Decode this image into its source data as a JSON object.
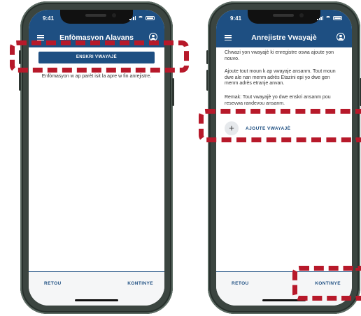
{
  "status_time": "9:41",
  "left_screen": {
    "title": "Enfòmasyon Alavans",
    "primary_button": "ENSKRI VWAYAJÈ",
    "info_text": "Enfòmasyon w ap parèt isit la apre w fin anrejistre.",
    "back_button": "RETOU",
    "continue_button": "KONTINYE"
  },
  "right_screen": {
    "title": "Anrejistre Vwayajè",
    "paragraphs": [
      "Chwazi yon vwayajè ki enregistre oswa ajoute yon nouvo.",
      "Ajoute tout moun k ap vwayaje ansanm. Tout moun dwe ale nan menm adrès Etazini epi yo dwe gen menm adrès etranje anvan.",
      "Remak: Tout vwayajè yo dwe enskri ansanm pou resevwa randevou ansanm."
    ],
    "add_button_label": "AJOUTE VWAYAJÈ",
    "back_button": "RETOU",
    "continue_button": "KONTINYE"
  },
  "highlight_color": "#b7192a",
  "brand_color": "#1e4f82",
  "icons": [
    "menu-icon",
    "profile-icon",
    "plus-icon",
    "signal-icon",
    "wifi-icon",
    "battery-icon"
  ]
}
